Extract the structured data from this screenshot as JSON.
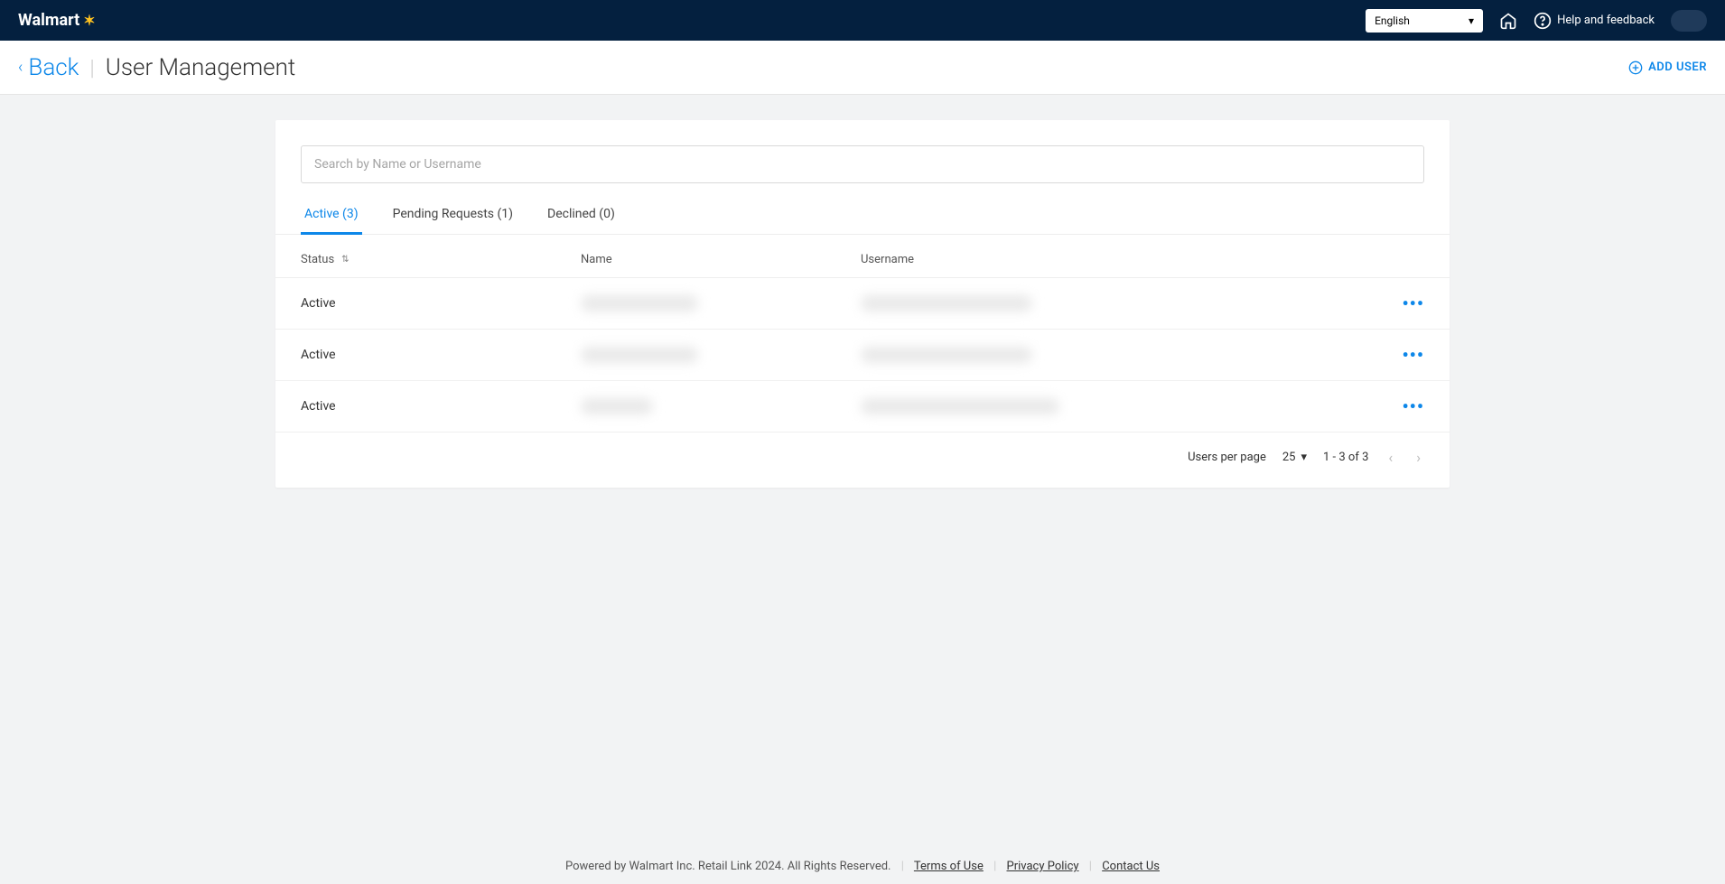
{
  "header": {
    "brand": "Walmart",
    "language": "English",
    "help_label": "Help and feedback"
  },
  "subheader": {
    "back_label": "Back",
    "page_title": "User Management",
    "add_user_label": "ADD USER"
  },
  "search": {
    "placeholder": "Search by Name or Username"
  },
  "tabs": [
    {
      "label": "Active (3)",
      "active": true
    },
    {
      "label": "Pending Requests (1)",
      "active": false
    },
    {
      "label": "Declined (0)",
      "active": false
    }
  ],
  "table": {
    "headers": {
      "status": "Status",
      "name": "Name",
      "username": "Username"
    },
    "rows": [
      {
        "status": "Active"
      },
      {
        "status": "Active"
      },
      {
        "status": "Active"
      }
    ]
  },
  "pagination": {
    "per_page_label": "Users per page",
    "per_page": "25",
    "range": "1 - 3 of 3"
  },
  "footer": {
    "copyright": "Powered by Walmart Inc. Retail Link 2024. All Rights Reserved.",
    "links": {
      "terms": "Terms of Use",
      "privacy": "Privacy Policy",
      "contact": "Contact Us"
    }
  }
}
